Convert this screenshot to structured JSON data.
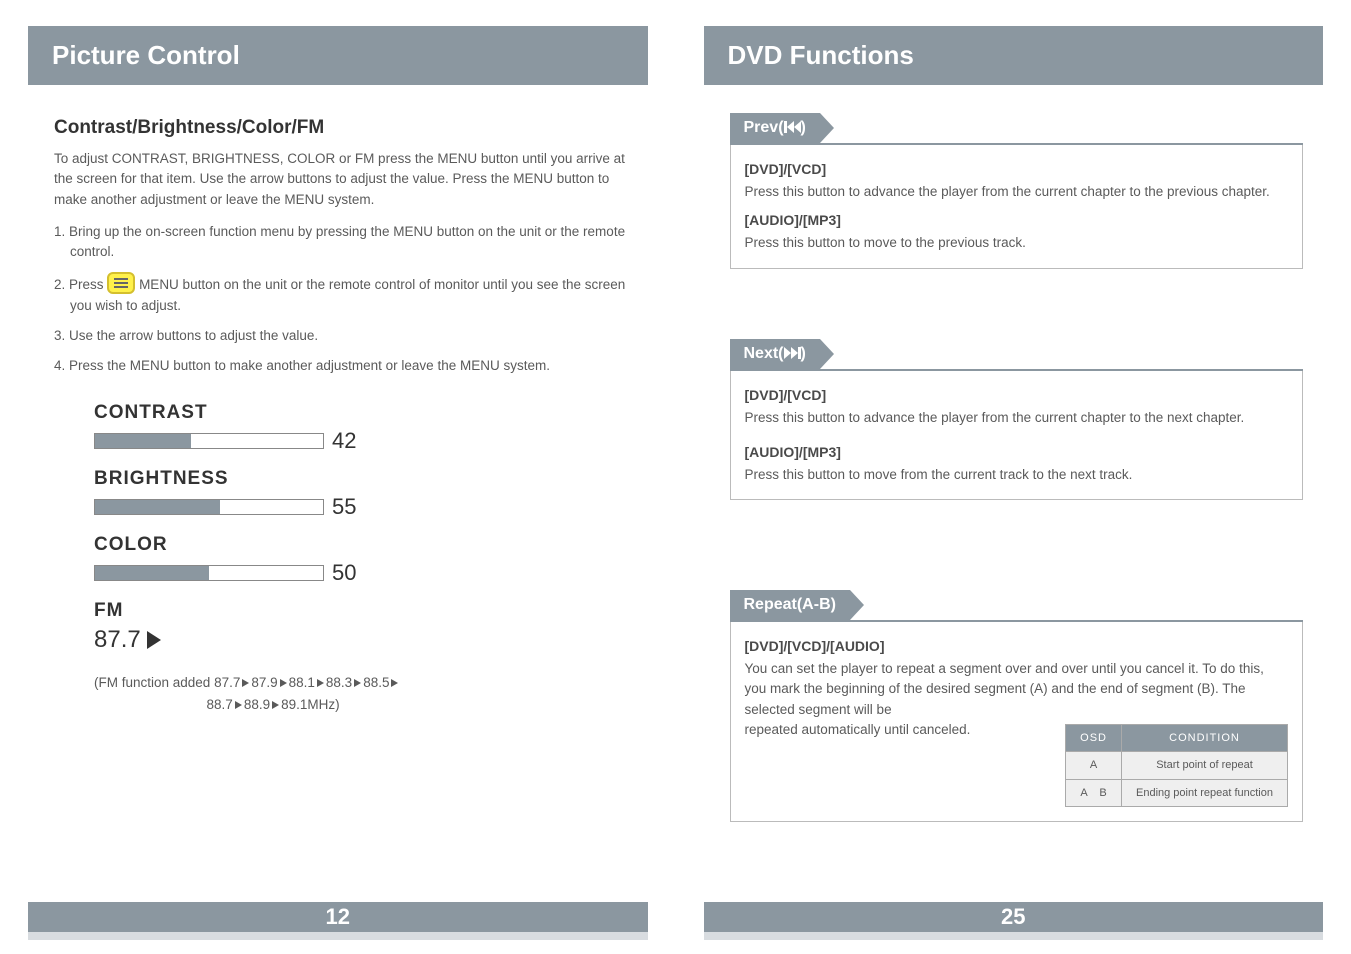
{
  "left": {
    "title": "Picture Control",
    "subhead": "Contrast/Brightness/Color/FM",
    "intro": "To adjust CONTRAST, BRIGHTNESS, COLOR or FM press the MENU button until you arrive at the screen for that item. Use the arrow buttons to adjust the value. Press the MENU button to make another adjustment or leave the MENU system.",
    "steps": {
      "s1": "1. Bring up the on-screen function menu by pressing the MENU button on the unit or the remote control.",
      "s2a": "2. Press",
      "s2b": "MENU button on the unit or the remote control of monitor until you see the screen you wish to adjust.",
      "s3": "3. Use the arrow buttons to adjust the value.",
      "s4": "4. Press the MENU button to make another adjustment or leave the MENU system."
    },
    "sliders": {
      "contrast": {
        "label": "CONTRAST",
        "value": "42",
        "pct": 42
      },
      "brightness": {
        "label": "BRIGHTNESS",
        "value": "55",
        "pct": 55
      },
      "color": {
        "label": "COLOR",
        "value": "50",
        "pct": 50
      },
      "fm": {
        "label": "FM",
        "value": "87.7"
      }
    },
    "fm_note_a": "(FM function added 87.7",
    "fm_note_vals": [
      "87.9",
      "88.1",
      "88.3",
      "88.5"
    ],
    "fm_note_b_vals": [
      "88.7",
      "88.9",
      "89.1MHz)"
    ],
    "page_num": "12"
  },
  "right": {
    "title": "DVD Functions",
    "prev": {
      "tag": "Prev(",
      "dvd_h": "[DVD]/[VCD]",
      "dvd_t": "Press this button to advance the player from the current chapter to the previous chapter.",
      "aud_h": "[AUDIO]/[MP3]",
      "aud_t": "Press this button to move to the previous track."
    },
    "next": {
      "tag": "Next(",
      "dvd_h": "[DVD]/[VCD]",
      "dvd_t": "Press this button to advance the player from the current chapter to the next chapter.",
      "aud_h": "[AUDIO]/[MP3]",
      "aud_t": "Press this button to move from the current track to the next track."
    },
    "repeat": {
      "tag": "Repeat(A-B)",
      "h": "[DVD]/[VCD]/[AUDIO]",
      "t": "You can set the player to repeat a segment over and over until you cancel it. To do this, you mark the beginning of the desired segment (A) and the end of segment (B). The selected segment will be",
      "t2": "repeated automatically until canceled.",
      "table": {
        "th1": "OSD",
        "th2": "CONDITION",
        "r1c1": "A",
        "r1c2": "Start point of repeat",
        "r2c1": "A    B",
        "r2c2": "Ending point repeat function"
      }
    },
    "page_num": "25"
  }
}
